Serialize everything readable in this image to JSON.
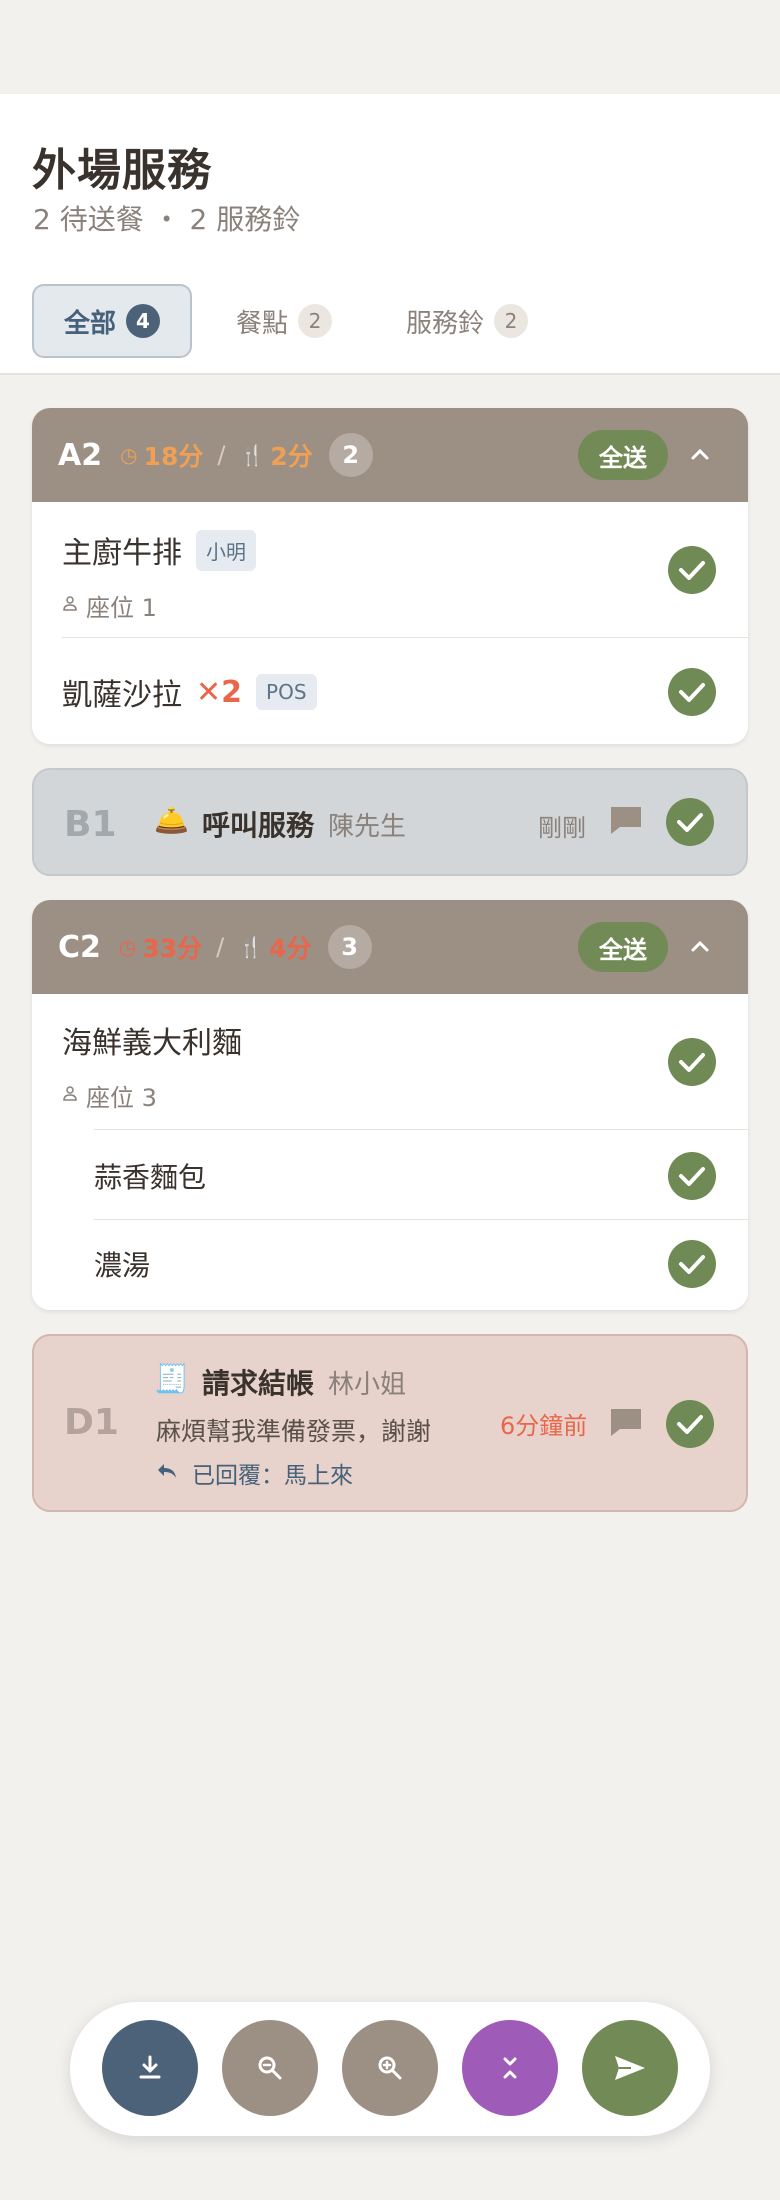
{
  "header": {
    "title": "外場服務",
    "subtitle": "2 待送餐 ・ 2 服務鈴"
  },
  "tabs": [
    {
      "label": "全部",
      "count": "4",
      "active": true
    },
    {
      "label": "餐點",
      "count": "2",
      "active": false
    },
    {
      "label": "服務鈴",
      "count": "2",
      "active": false
    }
  ],
  "orders": [
    {
      "table": "A2",
      "wait_time": "18分",
      "cook_time": "2分",
      "item_count": "2",
      "send_all_label": "全送",
      "items": [
        {
          "name": "主廚牛排",
          "tag": "小明",
          "seat": "座位 1"
        },
        {
          "name": "凱薩沙拉",
          "qty": "✕2",
          "tag": "POS"
        }
      ]
    },
    {
      "table": "C2",
      "wait_time": "33分",
      "cook_time": "4分",
      "item_count": "3",
      "send_all_label": "全送",
      "items": [
        {
          "name": "海鮮義大利麵",
          "seat": "座位 3"
        },
        {
          "name": "蒜香麵包"
        },
        {
          "name": "濃湯"
        }
      ]
    }
  ],
  "service_calls": [
    {
      "table": "B1",
      "emoji": "🛎️",
      "title": "呼叫服務",
      "customer": "陳先生",
      "time": "剛剛",
      "bg_color": "#d3d6d9",
      "time_color": "#8a817a"
    },
    {
      "table": "D1",
      "emoji": "🧾",
      "title": "請求結帳",
      "customer": "林小姐",
      "message": "麻煩幫我準備發票，謝謝",
      "reply": "已回覆：馬上來",
      "time": "6分鐘前",
      "bg_color": "#e8d3cc",
      "time_color": "#e9664a"
    }
  ],
  "toolbar": {
    "buttons": [
      {
        "name": "download-button",
        "icon": "download-icon",
        "color": "#4b6278"
      },
      {
        "name": "zoom-out-button",
        "icon": "zoom-out-icon",
        "color": "#9c8f84"
      },
      {
        "name": "zoom-in-button",
        "icon": "zoom-in-icon",
        "color": "#9c8f84"
      },
      {
        "name": "collapse-all-button",
        "icon": "collapse-all-icon",
        "color": "#9f5bb8"
      },
      {
        "name": "send-button",
        "icon": "send-icon",
        "color": "#728a55"
      }
    ]
  },
  "colors": {
    "accent_blue": "#4b6278",
    "header_brown": "#9c8f84",
    "confirm_green": "#6f8a55",
    "timer_orange": "#f0a055",
    "timer_red": "#e9664a"
  }
}
